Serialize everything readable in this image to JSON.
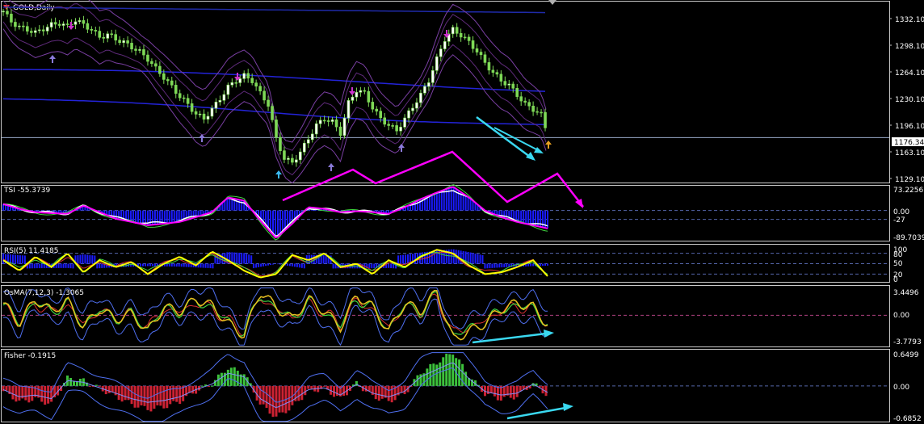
{
  "window": {
    "title": "GOLD,Daily"
  },
  "colors": {
    "background": "#000000",
    "frame": "#c8c8c8",
    "candle": "#7ed957",
    "trend_arrow": "#ff00ff",
    "trend_arrow_cyan": "#3ad8f0",
    "ma_blue": "#2323d8",
    "bands": "#7a3fa3",
    "tsi_main": "#ff00ff",
    "tsi_signal": "#ffffff",
    "hist_blue": "#1a1aff",
    "rsi_line": "#ffff00",
    "fisher_pos": "#3cc23c",
    "fisher_neg": "#cc2233",
    "current_price_line": "#9aa9c9"
  },
  "panels": {
    "price": {
      "label": "GOLD,Daily",
      "current_price": "1176.34",
      "y_ticks": [
        "1332.10",
        "1298.10",
        "1264.10",
        "1230.10",
        "1196.10",
        "1163.10",
        "1129.10"
      ]
    },
    "tsi": {
      "label": "TSI -55.3739",
      "y_ticks": [
        "73.2256",
        "0.00",
        "-27",
        "-89.7039"
      ]
    },
    "rsi": {
      "label": "RSI(5) 11.4185",
      "y_ticks": [
        "100",
        "80",
        "50",
        "20",
        "0"
      ]
    },
    "osma": {
      "label": "OsMA(7,12,3) -1.3065",
      "y_ticks": [
        "3.4496",
        "0.00",
        "-3.7793"
      ]
    },
    "fisher": {
      "label": "Fisher -0.1915",
      "y_ticks": [
        "0.6499",
        "0.00",
        "-0.6852"
      ]
    }
  },
  "chart_data": [
    {
      "type": "line",
      "title": "GOLD,Daily",
      "ylim": [
        1120,
        1345
      ],
      "x": [
        0,
        10,
        20,
        30,
        40,
        50,
        60,
        70,
        80,
        90,
        100,
        110,
        120,
        130,
        140,
        150,
        160,
        170,
        180,
        190,
        200,
        210,
        220,
        230,
        240,
        250,
        260,
        270,
        280,
        290,
        300,
        310,
        320,
        330,
        340,
        350,
        360,
        370,
        380,
        390,
        400,
        410,
        420,
        430,
        440,
        450,
        460,
        470,
        480,
        490,
        500,
        510,
        520,
        530,
        540,
        550,
        560,
        570,
        580,
        590,
        600,
        610,
        620,
        630,
        640,
        650,
        660,
        670,
        679
      ],
      "series": [
        {
          "name": "GOLD",
          "values": [
            1335,
            1322,
            1315,
            1312,
            1308,
            1313,
            1318,
            1320,
            1316,
            1324,
            1318,
            1312,
            1302,
            1306,
            1300,
            1296,
            1290,
            1284,
            1275,
            1263,
            1252,
            1240,
            1228,
            1218,
            1206,
            1200,
            1212,
            1225,
            1240,
            1248,
            1254,
            1248,
            1232,
            1218,
            1175,
            1150,
            1145,
            1158,
            1175,
            1192,
            1200,
            1196,
            1182,
            1220,
            1236,
            1232,
            1214,
            1200,
            1192,
            1185,
            1200,
            1215,
            1230,
            1248,
            1275,
            1300,
            1312,
            1305,
            1296,
            1285,
            1270,
            1258,
            1248,
            1242,
            1230,
            1218,
            1212,
            1205,
            1176.34
          ]
        }
      ]
    },
    {
      "type": "line",
      "title": "TSI -55.3739",
      "ylim": [
        -89.7039,
        73.2256
      ],
      "x": [
        0,
        20,
        40,
        60,
        80,
        100,
        120,
        140,
        160,
        180,
        200,
        220,
        240,
        260,
        280,
        300,
        320,
        340,
        360,
        380,
        400,
        420,
        440,
        460,
        480,
        500,
        520,
        540,
        560,
        580,
        600,
        620,
        640,
        660,
        679
      ],
      "series": [
        {
          "name": "TSI",
          "values": [
            20,
            5,
            -5,
            -8,
            -10,
            15,
            -5,
            -25,
            -35,
            -45,
            -40,
            -35,
            -20,
            -5,
            40,
            30,
            -30,
            -85,
            -40,
            10,
            5,
            -5,
            -2,
            -5,
            -10,
            10,
            35,
            55,
            73,
            40,
            0,
            -20,
            -35,
            -45,
            -55.3739
          ]
        }
      ]
    },
    {
      "type": "line",
      "title": "RSI(5) 11.4185",
      "ylim": [
        0,
        100
      ],
      "x": [
        0,
        20,
        40,
        60,
        80,
        100,
        120,
        140,
        160,
        180,
        200,
        220,
        240,
        260,
        280,
        300,
        320,
        340,
        360,
        380,
        400,
        420,
        440,
        460,
        480,
        500,
        520,
        540,
        560,
        580,
        600,
        620,
        640,
        660,
        679
      ],
      "series": [
        {
          "name": "RSI(5)",
          "values": [
            60,
            30,
            70,
            40,
            80,
            25,
            60,
            40,
            55,
            20,
            50,
            70,
            45,
            85,
            60,
            30,
            10,
            20,
            75,
            60,
            80,
            40,
            50,
            20,
            60,
            40,
            70,
            90,
            80,
            45,
            20,
            25,
            40,
            60,
            11.4185
          ]
        }
      ]
    },
    {
      "type": "line",
      "title": "OsMA(7,12,3) -1.3065",
      "ylim": [
        -3.7793,
        3.4496
      ],
      "x": [
        0,
        20,
        40,
        60,
        80,
        100,
        120,
        140,
        160,
        180,
        200,
        220,
        240,
        260,
        280,
        300,
        320,
        340,
        360,
        380,
        400,
        420,
        440,
        460,
        480,
        500,
        520,
        540,
        560,
        580,
        600,
        620,
        640,
        660,
        679
      ],
      "series": [
        {
          "name": "OsMA",
          "values": [
            1.5,
            -1.0,
            2.0,
            0.5,
            1.8,
            -1.5,
            0.8,
            -0.5,
            0.2,
            -2.0,
            1.0,
            0.5,
            2.0,
            1.2,
            -1.0,
            -2.5,
            3.0,
            1.0,
            -0.5,
            2.0,
            0.5,
            -1.5,
            2.5,
            1.0,
            -2.0,
            1.5,
            0.5,
            3.0,
            -3.0,
            -2.0,
            -1.0,
            0.8,
            1.5,
            1.0,
            -1.3065
          ]
        }
      ]
    },
    {
      "type": "bar",
      "title": "Fisher -0.1915",
      "ylim": [
        -0.6852,
        0.6499
      ],
      "x": [
        0,
        20,
        40,
        60,
        80,
        100,
        120,
        140,
        160,
        180,
        200,
        220,
        240,
        260,
        280,
        300,
        320,
        340,
        360,
        380,
        400,
        420,
        440,
        460,
        480,
        500,
        520,
        540,
        560,
        580,
        600,
        620,
        640,
        660,
        679
      ],
      "series": [
        {
          "name": "Fisher",
          "values": [
            -0.1,
            -0.3,
            -0.25,
            -0.35,
            0.15,
            0.1,
            -0.05,
            -0.2,
            -0.35,
            -0.45,
            -0.4,
            -0.3,
            -0.1,
            0.05,
            0.35,
            0.25,
            -0.35,
            -0.6,
            -0.4,
            -0.1,
            -0.05,
            -0.25,
            0.05,
            -0.2,
            -0.3,
            -0.15,
            0.25,
            0.45,
            0.65,
            0.2,
            -0.15,
            -0.25,
            -0.2,
            0.05,
            -0.1915
          ]
        }
      ]
    }
  ]
}
